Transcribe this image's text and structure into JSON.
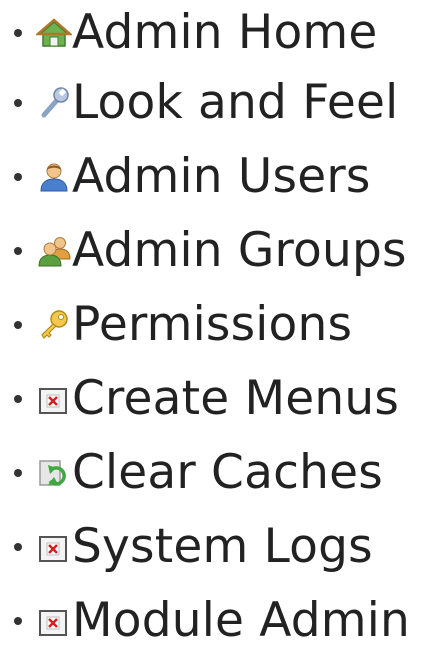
{
  "menu": {
    "items": [
      {
        "label": "Admin Home",
        "icon": "home-icon"
      },
      {
        "label": "Look and Feel",
        "icon": "wrench-icon"
      },
      {
        "label": "Admin Users",
        "icon": "user-icon"
      },
      {
        "label": "Admin Groups",
        "icon": "group-icon"
      },
      {
        "label": "Permissions",
        "icon": "key-icon"
      },
      {
        "label": "Create Menus",
        "icon": "broken-image-icon"
      },
      {
        "label": "Clear Caches",
        "icon": "refresh-icon"
      },
      {
        "label": "System Logs",
        "icon": "broken-image-icon"
      },
      {
        "label": "Module Admin",
        "icon": "broken-image-icon"
      }
    ]
  },
  "colors": {
    "text": "#222222",
    "bullet": "#333333",
    "home_icon": "#4a9a3a",
    "broken_image_x": "#d62020"
  }
}
